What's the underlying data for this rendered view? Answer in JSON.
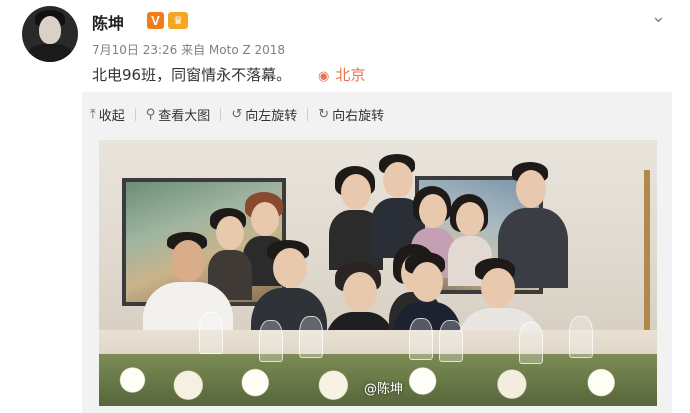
{
  "post": {
    "author_name": "陈坤",
    "verified_badge": "V",
    "level_badge": "♛",
    "meta": "7月10日 23:26 来自 Moto Z 2018",
    "text": "北电96班，同窗情永不落幕。",
    "location": "北京",
    "menu_icon": "chevron-down-icon"
  },
  "toolbar": {
    "items": [
      {
        "icon": "collapse-icon",
        "label": "收起"
      },
      {
        "icon": "zoom-icon",
        "label": "查看大图"
      },
      {
        "icon": "rotate-left-icon",
        "label": "向左旋转"
      },
      {
        "icon": "rotate-right-icon",
        "label": "向右旋转"
      }
    ]
  },
  "photo": {
    "watermark": "@陈坤"
  },
  "colors": {
    "location": "#eb7350",
    "verified": "#f27b1a",
    "panel_bg": "#f2f2f2"
  }
}
